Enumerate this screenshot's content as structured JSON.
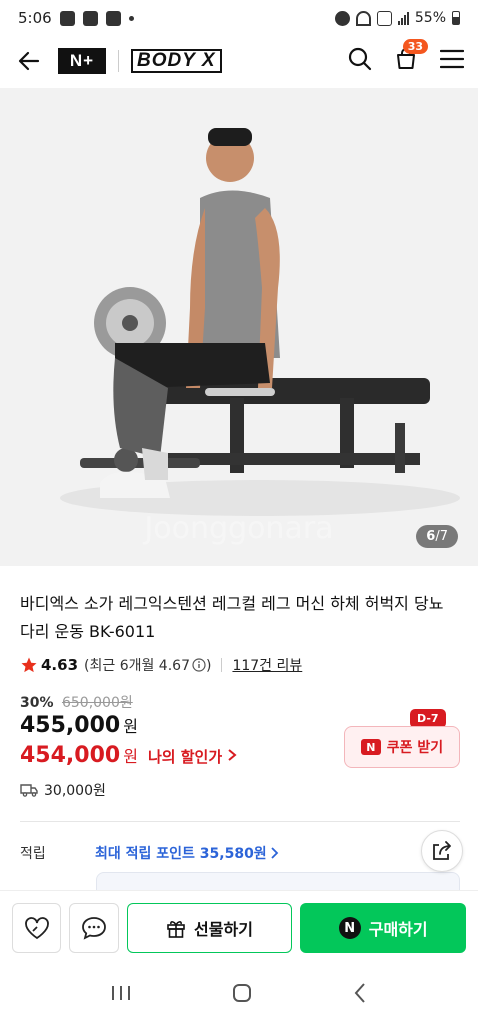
{
  "status_bar": {
    "time": "5:06",
    "battery": "55%"
  },
  "header": {
    "np_logo": "N+",
    "brand_logo": "BODY X",
    "cart_count": "33"
  },
  "gallery": {
    "current": "6",
    "total": "/7",
    "watermark": "Joonggonara"
  },
  "product": {
    "title": "바디엑스 소가 레그익스텐션 레그컬 레그 머신 하체 허벅지 당뇨 다리 운동 BK-6011",
    "rating": "4.63",
    "recent_rating": "(최근 6개월 4.67",
    "recent_rating_close": ")",
    "reviews": "117건 리뷰",
    "discount_pct": "30%",
    "original_price": "650,000원",
    "price": "455,000",
    "price_unit": "원",
    "sale_price": "454,000",
    "sale_unit": "원",
    "my_discount": "나의 할인가",
    "shipping": "30,000원"
  },
  "coupon": {
    "badge": "D-7",
    "mark": "N",
    "label": "쿠폰 받기"
  },
  "points": {
    "label": "적립",
    "value": "최대 적립 포인트 35,580원"
  },
  "bottom_bar": {
    "gift_label": "선물하기",
    "buy_label": "구매하기",
    "buy_mark": "N"
  },
  "colors": {
    "accent_green": "#03c75a",
    "sale_red": "#d81b21",
    "points_blue": "#2c64d8",
    "cart_badge": "#f4571f"
  }
}
